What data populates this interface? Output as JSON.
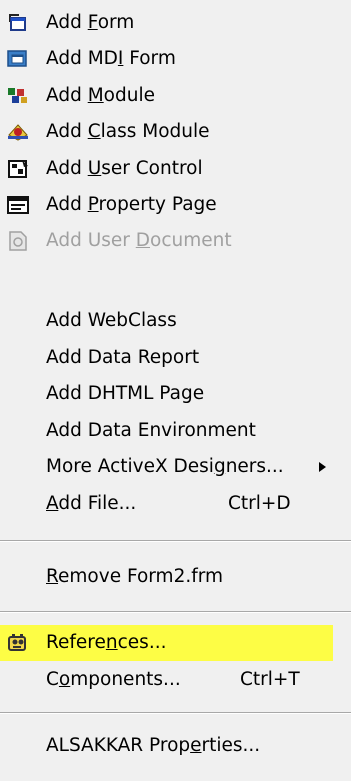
{
  "menu": {
    "items": [
      {
        "name": "add-form",
        "pre": "Add ",
        "acc": "F",
        "post": "orm",
        "icon": "form-icon"
      },
      {
        "name": "add-mdi-form",
        "pre": "Add MD",
        "acc": "I",
        "post": " Form",
        "icon": "mdi-form-icon"
      },
      {
        "name": "add-module",
        "pre": "Add ",
        "acc": "M",
        "post": "odule",
        "icon": "module-icon"
      },
      {
        "name": "add-class-module",
        "pre": "Add ",
        "acc": "C",
        "post": "lass Module",
        "icon": "class-module-icon"
      },
      {
        "name": "add-user-control",
        "pre": "Add ",
        "acc": "U",
        "post": "ser Control",
        "icon": "user-control-icon"
      },
      {
        "name": "add-property-page",
        "pre": "Add ",
        "acc": "P",
        "post": "roperty Page",
        "icon": "property-page-icon"
      },
      {
        "name": "add-user-document",
        "pre": "Add User ",
        "acc": "D",
        "post": "ocument",
        "icon": "user-document-icon",
        "disabled": true
      },
      {
        "name": "add-webclass",
        "pre": "Add WebClass",
        "acc": "",
        "post": ""
      },
      {
        "name": "add-data-report",
        "pre": "Add Data Report",
        "acc": "",
        "post": ""
      },
      {
        "name": "add-dhtml-page",
        "pre": "Add DHTML Page",
        "acc": "",
        "post": ""
      },
      {
        "name": "add-data-environment",
        "pre": "Add Data Environment",
        "acc": "",
        "post": ""
      },
      {
        "name": "more-activex-designers",
        "pre": "More ActiveX Desi",
        "acc": "g",
        "post": "ners...",
        "submenu": true
      },
      {
        "name": "add-file",
        "pre": "",
        "acc": "A",
        "post": "dd File...",
        "shortcut": "Ctrl+D"
      },
      {
        "name": "remove-form2",
        "pre": "",
        "acc": "R",
        "post": "emove Form2.frm"
      },
      {
        "name": "references",
        "pre": "Refere",
        "acc": "n",
        "post": "ces...",
        "icon": "references-icon",
        "highlighted": true
      },
      {
        "name": "components",
        "pre": "C",
        "acc": "o",
        "post": "mponents...",
        "shortcut": "Ctrl+T"
      },
      {
        "name": "alsakkar-properties",
        "pre": "ALSAKKAR Prop",
        "acc": "e",
        "post": "rties..."
      }
    ]
  },
  "colors": {
    "highlight": "#fdfd45",
    "disabled_text": "#a0a0a0",
    "menu_bg": "#f0f0f0"
  }
}
